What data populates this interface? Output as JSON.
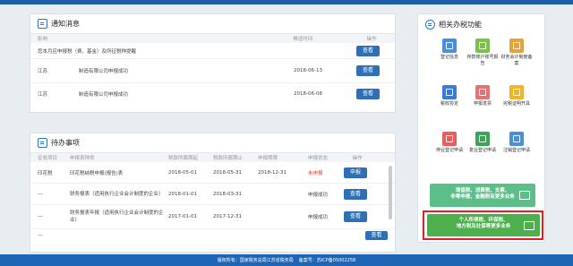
{
  "notifications": {
    "title": "通知消息",
    "columns": [
      "影响",
      "推送时间",
      "操作"
    ],
    "rows": [
      {
        "text": "您本月应申报税（费、基金）及所征税种提醒",
        "date": "",
        "action": "查看"
      },
      {
        "region": "江苏",
        "text": "制造有限公司申报成功",
        "date": "2018-06-13",
        "action": "查看"
      },
      {
        "region": "江苏",
        "text": "制造有限公司申报成功",
        "date": "2018-06-08",
        "action": "查看"
      }
    ]
  },
  "todo": {
    "title": "待办事项",
    "columns": [
      "征收项目",
      "申报表种类",
      "税款所属期起",
      "税款所属期止",
      "申报期限",
      "申报状态",
      "操作"
    ],
    "rows": [
      {
        "project": "印花税",
        "form": "印花税纳税申报(报告)表",
        "start": "2018-05-01",
        "end": "2018-05-31",
        "deadline": "2018-12-31",
        "status": "未申报",
        "action": "申报"
      },
      {
        "project": "---",
        "form": "财务报表（适用执行企业会计制度的企业）",
        "start": "2018-01-01",
        "end": "2018-03-31",
        "deadline": "",
        "status": "申报成功",
        "action": "查看"
      },
      {
        "project": "---",
        "form": "财务报表年报（适用执行企业会计制度的企业）",
        "start": "2017-01-01",
        "end": "2017-12-31",
        "deadline": "",
        "status": "申报成功",
        "action": "查看"
      },
      {
        "project": "---",
        "form": "",
        "start": "",
        "end": "",
        "deadline": "",
        "status": "",
        "action": "查看"
      }
    ]
  },
  "related": {
    "title": "相关办税功能",
    "items": [
      {
        "label": "登记信息",
        "icon": "registration-icon",
        "color": "#4a90d9"
      },
      {
        "label": "存款账户账号报告",
        "icon": "bank-card-icon",
        "color": "#7cc24a"
      },
      {
        "label": "财务会计制度备案",
        "icon": "finance-icon",
        "color": "#e8a23a"
      },
      {
        "label": "税收协定",
        "icon": "agreement-icon",
        "color": "#3a7bd5"
      },
      {
        "label": "申报发票",
        "icon": "invoice-icon",
        "color": "#e57373"
      },
      {
        "label": "完税证明开具",
        "icon": "certificate-icon",
        "color": "#f0b429"
      },
      {
        "label": "停业登记申请",
        "icon": "suspend-icon",
        "color": "#e85d5d"
      },
      {
        "label": "复业登记申请",
        "icon": "resume-icon",
        "color": "#3ca35a"
      },
      {
        "label": "注销登记申请",
        "icon": "cancel-registration-icon",
        "color": "#4b8fd6"
      }
    ],
    "promo1": {
      "line1": "增值税、消费税、支票、",
      "line2": "非零申报、金融税有更多业务",
      "color": "#5cbf8a"
    },
    "promo2": {
      "line1": "个人所得税、环保税、",
      "line2": "地方税及社保等更多业务",
      "color": "#4db04d",
      "highlight": "#e21f1f"
    }
  },
  "footer": {
    "copyright": "版权所有：国家税务总局江苏省税务局",
    "icp": "备案号：苏ICP备05002258"
  }
}
